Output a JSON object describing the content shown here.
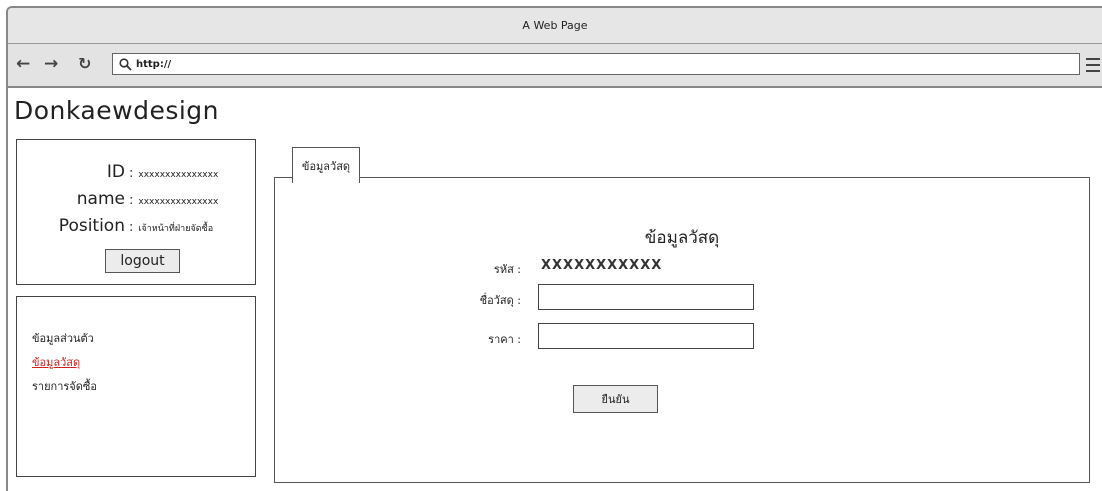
{
  "window": {
    "title": "A Web Page"
  },
  "browser": {
    "url": "http://"
  },
  "brand": {
    "name": "Donkaewdesign"
  },
  "user": {
    "fields": [
      {
        "key": "ID",
        "value": "xxxxxxxxxxxxxxx"
      },
      {
        "key": "name",
        "value": "xxxxxxxxxxxxxxx"
      },
      {
        "key": "Position",
        "value": "เจ้าหน้าที่ฝ่ายจัดซื้อ"
      }
    ],
    "logout_label": "logout"
  },
  "menu": {
    "items": [
      {
        "label": "ข้อมูลส่วนตัว",
        "active": false
      },
      {
        "label": "ข้อมูลวัสดุ",
        "active": true
      },
      {
        "label": "รายการจัดซื้อ",
        "active": false
      }
    ],
    "active_color": "#cc1f1f"
  },
  "tab": {
    "label": "ข้อมูลวัสดุ"
  },
  "form": {
    "title": "ข้อมูลวัสดุ",
    "code_label": "รหัส",
    "code_value": "XXXXXXXXXXX",
    "name_label": "ชื่อวัสดุ",
    "name_value": "",
    "price_label": "ราคา",
    "price_value": "",
    "colon": ":",
    "confirm_label": "ยืนยัน"
  }
}
